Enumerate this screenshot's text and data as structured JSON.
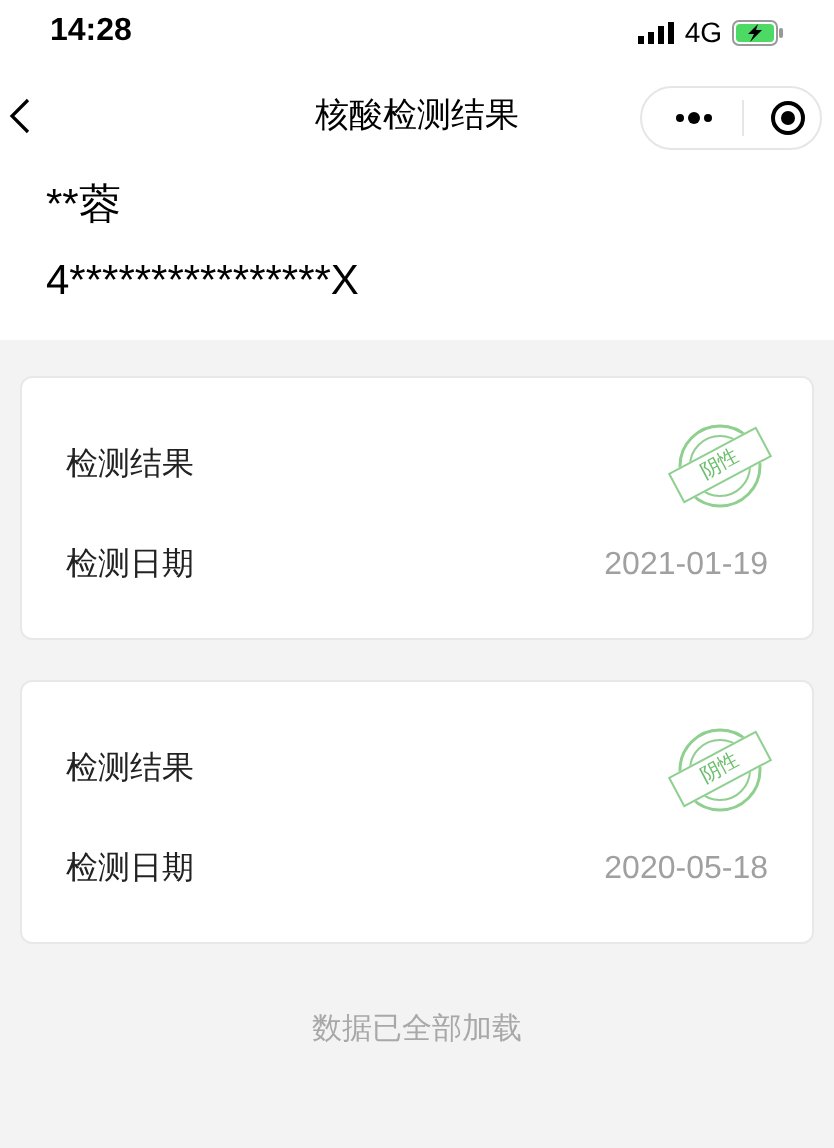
{
  "status_bar": {
    "time": "14:28",
    "network": "4G"
  },
  "nav": {
    "title": "核酸检测结果"
  },
  "person": {
    "name": "**蓉",
    "id_number": "4****************X"
  },
  "records": [
    {
      "result_label": "检测结果",
      "result": "阴性",
      "date_label": "检测日期",
      "date": "2021-01-19"
    },
    {
      "result_label": "检测结果",
      "result": "阴性",
      "date_label": "检测日期",
      "date": "2020-05-18"
    }
  ],
  "footer": "数据已全部加载"
}
